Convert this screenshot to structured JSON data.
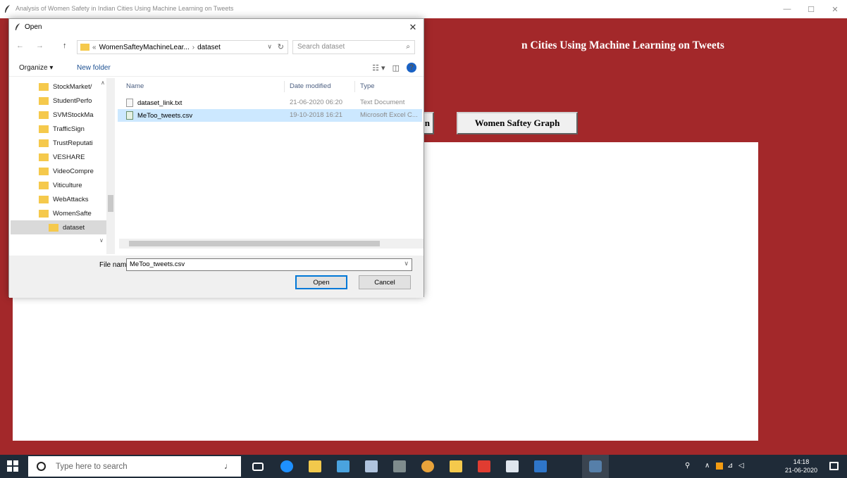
{
  "app_window": {
    "title": "Analysis of Women Safety in Indian Cities Using Machine Learning on Tweets",
    "controls": {
      "minimize": "—",
      "maximize": "☐",
      "close": "✕"
    }
  },
  "app": {
    "heading_visible": "n Cities Using Machine Learning on Tweets",
    "partial_button_label": "n",
    "graph_button_label": "Women Saftey Graph"
  },
  "dialog": {
    "title": "Open",
    "close_label": "✕",
    "nav": {
      "back": "←",
      "forward": "→",
      "up": "↑"
    },
    "address": {
      "prefix": "«",
      "segment1": "WomenSafteyMachineLear...",
      "separator": "›",
      "segment2": "dataset",
      "dropdown": "∨",
      "refresh": "↻"
    },
    "search": {
      "placeholder": "Search dataset",
      "icon": "⌕"
    },
    "toolbar": {
      "organize": "Organize ▾",
      "new_folder": "New folder",
      "view": "☷ ▾",
      "pane": "◫",
      "help": "?"
    },
    "nav_pane": {
      "items": [
        "StockMarket/",
        "StudentPerfo",
        "SVMStockMa",
        "TrafficSign",
        "TrustReputati",
        "VESHARE",
        "VideoCompre",
        "Viticulture",
        "WebAttacks",
        "WomenSafte",
        "dataset"
      ],
      "selected_index": 10,
      "collapse": "∧",
      "expand": "∨"
    },
    "columns": {
      "name": "Name",
      "date": "Date modified",
      "type": "Type"
    },
    "files": [
      {
        "name": "dataset_link.txt",
        "date": "21-06-2020 06:20",
        "type": "Text Document",
        "selected": false
      },
      {
        "name": "MeToo_tweets.csv",
        "date": "19-10-2018 16:21",
        "type": "Microsoft Excel C...",
        "selected": true
      }
    ],
    "footer": {
      "file_name_label": "File name:",
      "file_name_value": "MeToo_tweets.csv",
      "dropdown": "∨",
      "open_label": "Open",
      "cancel_label": "Cancel"
    }
  },
  "taskbar": {
    "search_placeholder": "Type here to search",
    "clock_time": "14:18",
    "clock_date": "21-06-2020",
    "tray_chevron": "∧"
  },
  "colors": {
    "app_background": "#a3282a",
    "selection": "#cce8ff",
    "taskbar": "#1f2b38",
    "accent": "#0078d7"
  }
}
